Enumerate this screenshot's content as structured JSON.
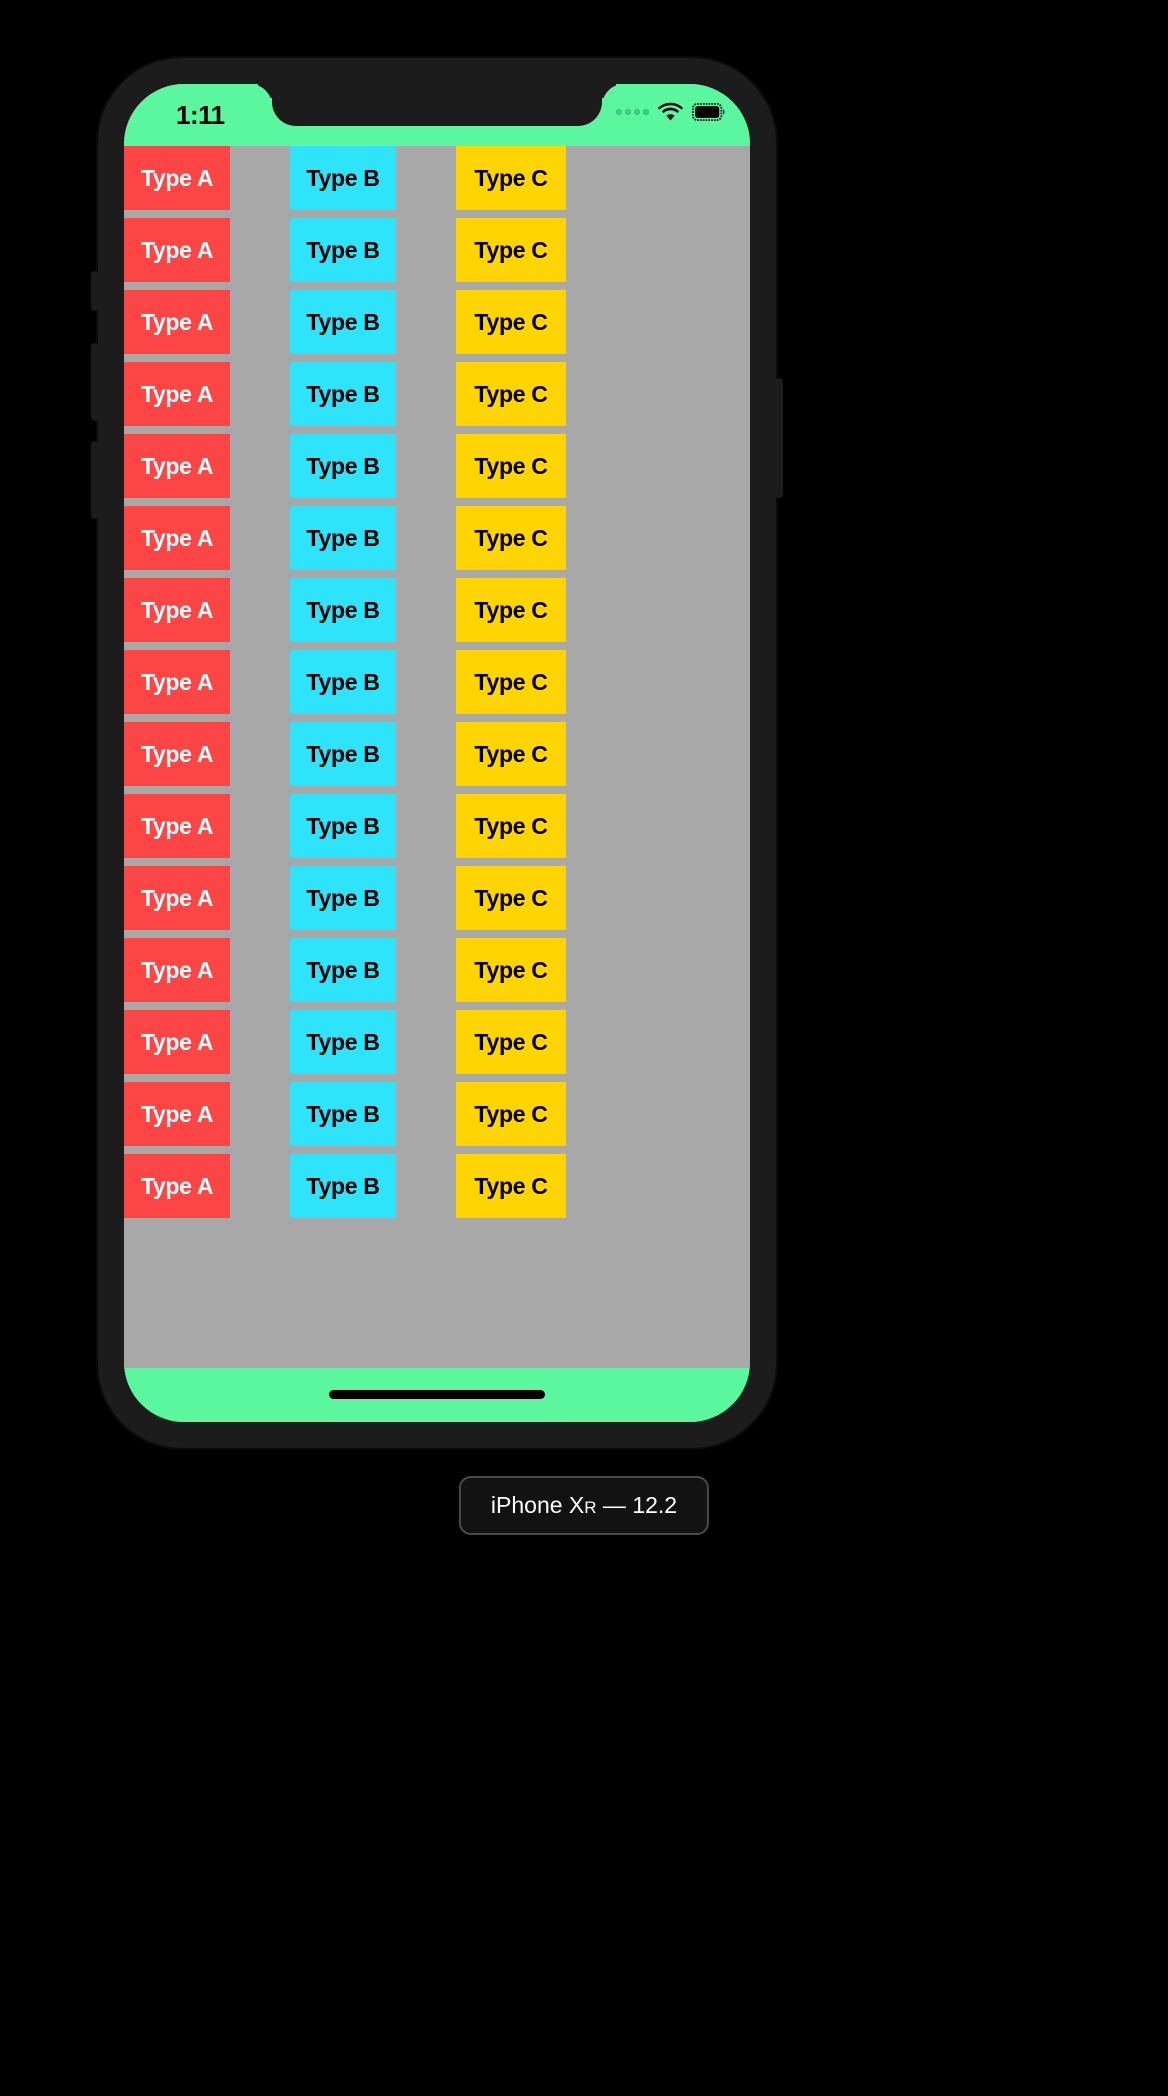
{
  "simulator": {
    "caption_device": "iPhone X",
    "caption_device_suffix": "R",
    "caption_os": " — 12.2"
  },
  "status_bar": {
    "time": "1:11",
    "icons": [
      "signal-dots-icon",
      "wifi-icon",
      "battery-icon"
    ],
    "background_color": "#5af79e"
  },
  "colors": {
    "screen_background": "#a8a8a8",
    "accent_green": "#5af79e",
    "type_a": "#fc4545",
    "type_b": "#2fe3fb",
    "type_c": "#ffd400",
    "type_a_text": "#ffffff",
    "type_b_text": "#000000",
    "type_c_text": "#000000",
    "frame": "#1c1c1c"
  },
  "list": {
    "columns": [
      {
        "key": "a",
        "label": "Type A"
      },
      {
        "key": "b",
        "label": "Type B"
      },
      {
        "key": "c",
        "label": "Type C"
      }
    ],
    "row_count": 15,
    "rows": [
      {
        "a": "Type A",
        "b": "Type B",
        "c": "Type C"
      },
      {
        "a": "Type A",
        "b": "Type B",
        "c": "Type C"
      },
      {
        "a": "Type A",
        "b": "Type B",
        "c": "Type C"
      },
      {
        "a": "Type A",
        "b": "Type B",
        "c": "Type C"
      },
      {
        "a": "Type A",
        "b": "Type B",
        "c": "Type C"
      },
      {
        "a": "Type A",
        "b": "Type B",
        "c": "Type C"
      },
      {
        "a": "Type A",
        "b": "Type B",
        "c": "Type C"
      },
      {
        "a": "Type A",
        "b": "Type B",
        "c": "Type C"
      },
      {
        "a": "Type A",
        "b": "Type B",
        "c": "Type C"
      },
      {
        "a": "Type A",
        "b": "Type B",
        "c": "Type C"
      },
      {
        "a": "Type A",
        "b": "Type B",
        "c": "Type C"
      },
      {
        "a": "Type A",
        "b": "Type B",
        "c": "Type C"
      },
      {
        "a": "Type A",
        "b": "Type B",
        "c": "Type C"
      },
      {
        "a": "Type A",
        "b": "Type B",
        "c": "Type C"
      },
      {
        "a": "Type A",
        "b": "Type B",
        "c": "Type C"
      }
    ]
  },
  "home_indicator": {
    "name": "home-indicator"
  }
}
